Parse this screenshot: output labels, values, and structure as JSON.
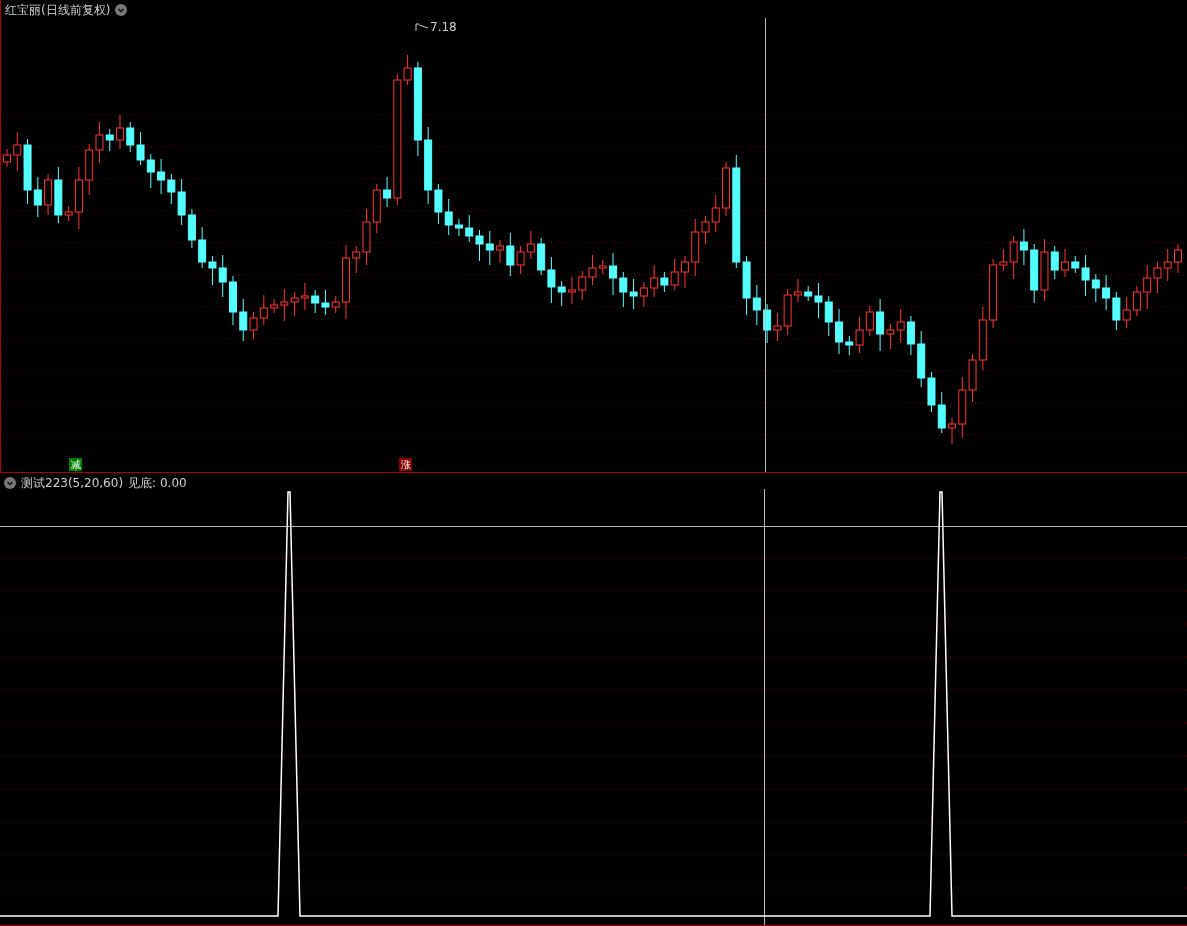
{
  "chart": {
    "title": "红宝丽(日线前复权)",
    "high_label": "7.18",
    "markers": [
      {
        "text": "减",
        "color": "#008000"
      },
      {
        "text": "涨",
        "color": "#8b0000"
      }
    ]
  },
  "indicator": {
    "name": "测试223(5,20,60)",
    "reading": "见底: 0.00"
  }
}
